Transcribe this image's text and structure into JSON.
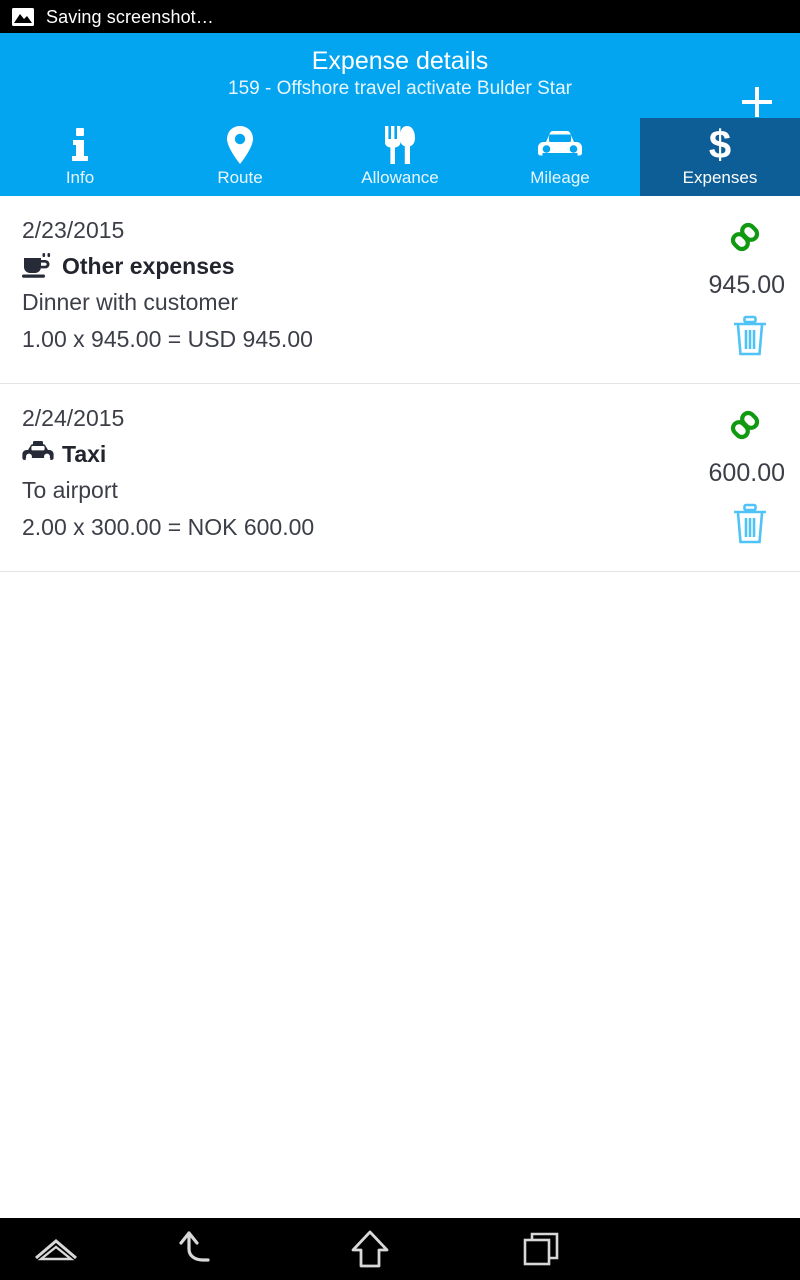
{
  "status_bar": {
    "icon": "image-icon",
    "text": "Saving screenshot…"
  },
  "app_bar": {
    "title": "Expense details",
    "subtitle": "159 - Offshore travel activate Bulder Star",
    "add_button": "+",
    "background_color": "#03a5f0",
    "selected_tab_color": "#0d5e96"
  },
  "tabs": [
    {
      "label": "Info",
      "icon": "info-icon",
      "selected": false
    },
    {
      "label": "Route",
      "icon": "map-pin-icon",
      "selected": false
    },
    {
      "label": "Allowance",
      "icon": "fork-knife-icon",
      "selected": false
    },
    {
      "label": "Mileage",
      "icon": "car-icon",
      "selected": false
    },
    {
      "label": "Expenses",
      "icon": "dollar-icon",
      "selected": true
    }
  ],
  "expenses": [
    {
      "date": "2/23/2015",
      "type": "Other expenses",
      "type_icon": "coffee-cup-icon",
      "description": "Dinner with customer",
      "calculation": "1.00 x 945.00 = USD 945.00",
      "amount": "945.00",
      "link_icon": "chain-link-icon",
      "delete_icon": "trash-icon"
    },
    {
      "date": "2/24/2015",
      "type": "Taxi",
      "type_icon": "taxi-icon",
      "description": "To airport",
      "calculation": "2.00 x 300.00 = NOK 600.00",
      "amount": "600.00",
      "link_icon": "chain-link-icon",
      "delete_icon": "trash-icon"
    }
  ],
  "nav_bar": {
    "buttons": [
      {
        "name": "menu-up-icon"
      },
      {
        "name": "back-icon"
      },
      {
        "name": "home-icon"
      },
      {
        "name": "recents-icon"
      }
    ]
  },
  "colors": {
    "accent_blue": "#03a5f0",
    "dark_blue": "#0d5e96",
    "link_green": "#119911",
    "trash_blue": "#4fc3f7",
    "text_dark": "#3c3f47"
  }
}
